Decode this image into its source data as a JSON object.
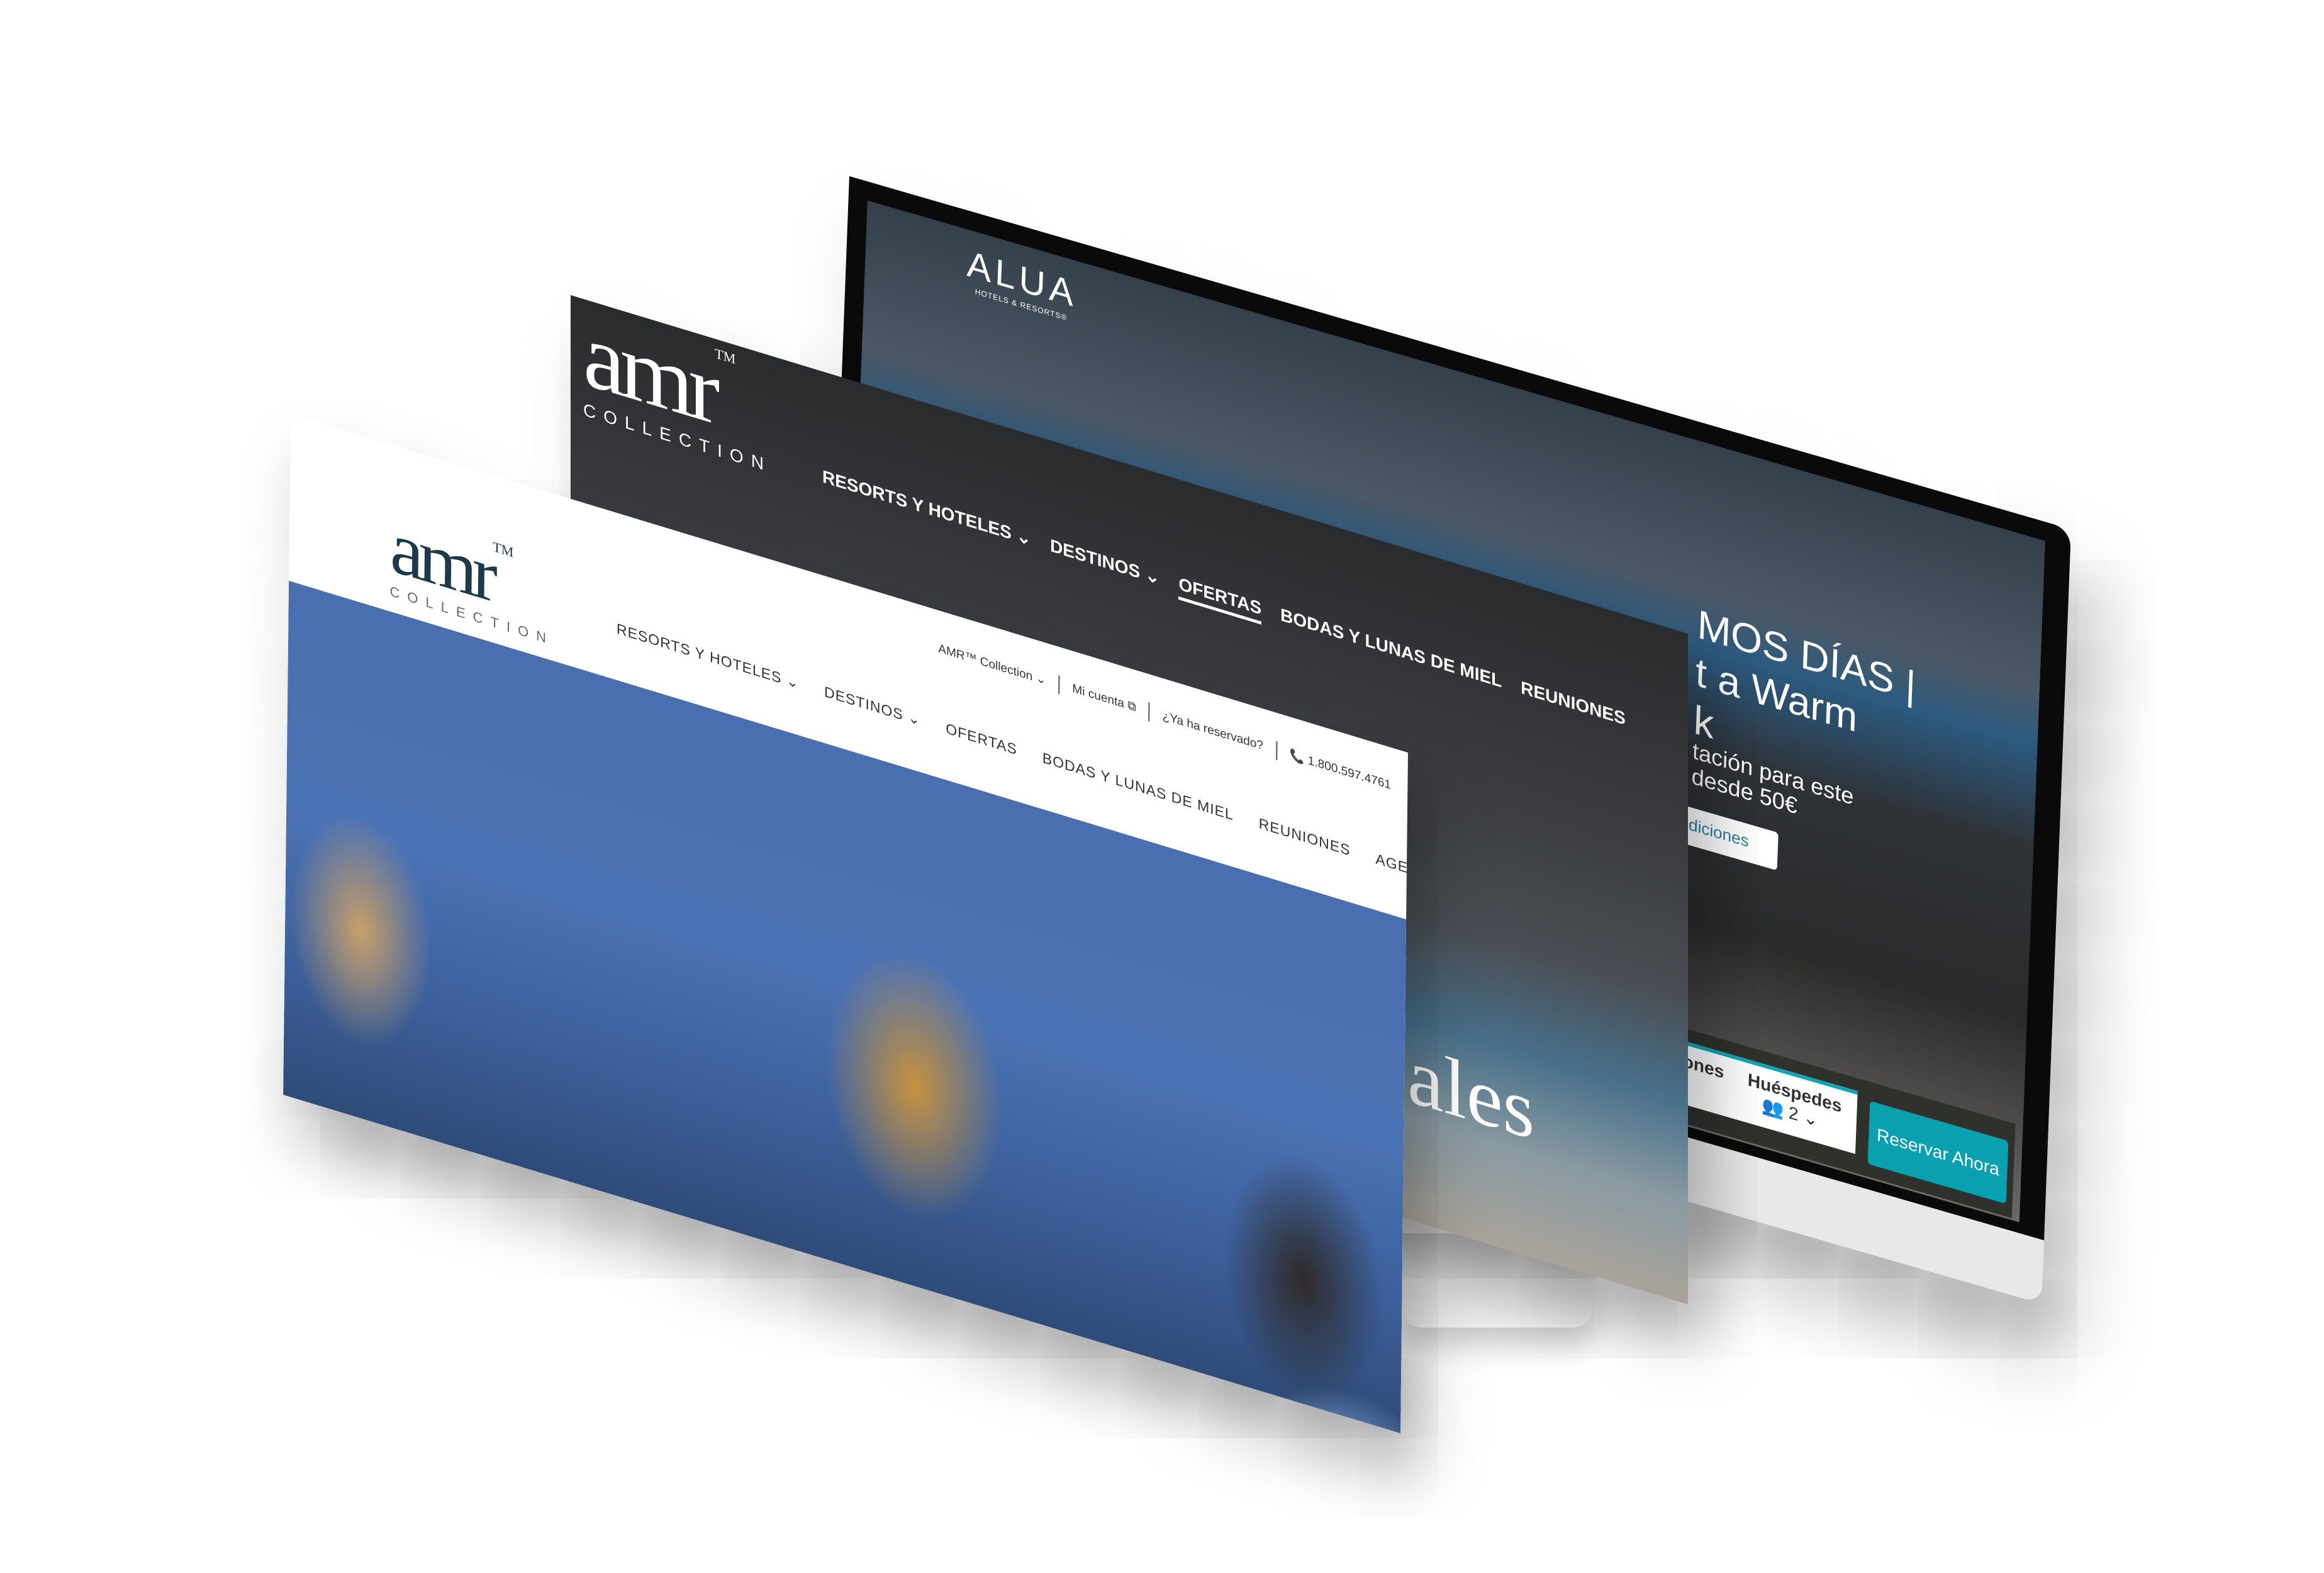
{
  "monitor": {
    "brand": {
      "name": "ALUA",
      "tagline": "HOTELS & RESORTS®"
    },
    "hero": {
      "line1": "MOS DÍAS |",
      "line2": "t a Warm",
      "line3": "k",
      "sub1": "tación para este",
      "sub2": "desde 50€"
    },
    "conditions_button": "ndiciones",
    "booking": {
      "partial_label": "ciones",
      "guests_label": "Huéspedes",
      "guests_value": "2",
      "reserve_button": "Reservar Ahora"
    },
    "accent_color": "#0aa0b0"
  },
  "middle": {
    "logo": {
      "mark": "amr",
      "tm": "TM",
      "sub": "COLLECTION"
    },
    "nav": [
      "RESORTS Y HOTELES",
      "DESTINOS",
      "OFERTAS",
      "BODAS Y LUNAS DE MIEL",
      "REUNIONES"
    ],
    "active_nav": "OFERTAS",
    "hero_fragment": "ales"
  },
  "front": {
    "logo": {
      "mark": "amr",
      "tm": "TM",
      "sub": "COLLECTION"
    },
    "utility": {
      "collection": "AMR™ Collection",
      "account": "Mi cuenta",
      "booked": "¿Ya ha reservado?",
      "phone": "1.800.597.4761"
    },
    "nav": [
      "RESORTS Y HOTELES",
      "DESTINOS",
      "OFERTAS",
      "BODAS Y LUNAS DE MIEL",
      "REUNIONES",
      "AGENTES DE VIAJES"
    ],
    "brand_color": "#1c3a4a"
  }
}
